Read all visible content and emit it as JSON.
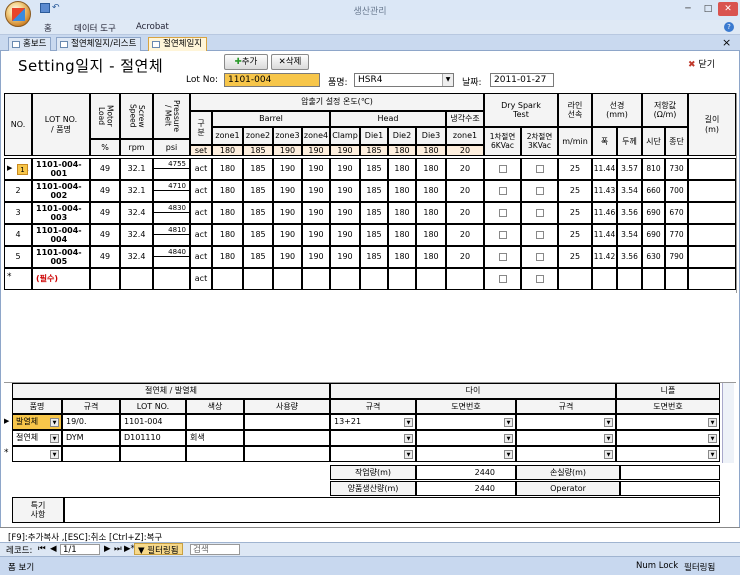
{
  "window": {
    "title": "생산관리",
    "minimize": "─",
    "maximize": "□",
    "close": "✕"
  },
  "ribbon": {
    "tabs": [
      "홈",
      "데이터 도구",
      "Acrobat"
    ]
  },
  "doc_tabs": [
    {
      "label": "홈보드"
    },
    {
      "label": "절연체일지/리스트"
    },
    {
      "label": "절연체일지"
    }
  ],
  "doc_close": "×",
  "form": {
    "title": "Setting일지  -  절연체",
    "add_label": "추가",
    "delete_label": "삭제",
    "close_label": "닫기",
    "lot_label": "Lot No:",
    "lot_value": "1101-004",
    "product_label": "품명:",
    "product_value": "HSR4",
    "date_label": "날짜:",
    "date_value": "2011-01-27"
  },
  "grid": {
    "headers": {
      "no": "NO.",
      "lot": "LOT NO.\n/ 품명",
      "motor": "Motor\nLoad",
      "screw": "Screw\nSpeed",
      "pressure": "Pressure\n/ Melt",
      "temp_group": "압출기 설정 온도(℃)",
      "gubun": "구\n분",
      "barrel": "Barrel",
      "head": "Head",
      "cool": "냉각수조",
      "zones": [
        "zone1",
        "zone2",
        "zone3",
        "zone4",
        "Clamp",
        "Die1",
        "Die2",
        "Die3",
        "zone1"
      ],
      "dry": "Dry Spark\nTest",
      "dry1": "1차절연\n6KVac",
      "dry2": "2차절연\n3KVac",
      "line": "라인\n선속",
      "line_unit": "m/min",
      "dia": "선경\n(mm)",
      "dia_w": "폭",
      "dia_t": "두께",
      "res": "저항값\n(Ω/m)",
      "res_s": "시단",
      "res_e": "종단",
      "len": "길이\n(m)",
      "motor_unit": "%",
      "screw_unit": "rpm",
      "pressure_unit": "psi",
      "set": "set",
      "set_values": [
        "180",
        "185",
        "190",
        "190",
        "190",
        "185",
        "180",
        "180",
        "20"
      ]
    },
    "rows": [
      {
        "no": "1",
        "lot": "1101-004-\n001",
        "motor": "49",
        "screw": "32.1",
        "p": "4755",
        "gubun": "act",
        "z": [
          "180",
          "185",
          "190",
          "190",
          "190",
          "185",
          "180",
          "180",
          "20"
        ],
        "line": "25",
        "w": "11.44",
        "t": "3.57",
        "rs": "810",
        "re": "730"
      },
      {
        "no": "2",
        "lot": "1101-004-\n002",
        "motor": "49",
        "screw": "32.1",
        "p": "4710",
        "gubun": "act",
        "z": [
          "180",
          "185",
          "190",
          "190",
          "190",
          "185",
          "180",
          "180",
          "20"
        ],
        "line": "25",
        "w": "11.43",
        "t": "3.54",
        "rs": "660",
        "re": "700"
      },
      {
        "no": "3",
        "lot": "1101-004-\n003",
        "motor": "49",
        "screw": "32.4",
        "p": "4830",
        "gubun": "act",
        "z": [
          "180",
          "185",
          "190",
          "190",
          "190",
          "185",
          "180",
          "180",
          "20"
        ],
        "line": "25",
        "w": "11.46",
        "t": "3.56",
        "rs": "690",
        "re": "670"
      },
      {
        "no": "4",
        "lot": "1101-004-\n004",
        "motor": "49",
        "screw": "32.4",
        "p": "4810",
        "gubun": "act",
        "z": [
          "180",
          "185",
          "190",
          "190",
          "190",
          "185",
          "180",
          "180",
          "20"
        ],
        "line": "25",
        "w": "11.44",
        "t": "3.54",
        "rs": "690",
        "re": "770"
      },
      {
        "no": "5",
        "lot": "1101-004-\n005",
        "motor": "49",
        "screw": "32.4",
        "p": "4840",
        "gubun": "act",
        "z": [
          "180",
          "185",
          "190",
          "190",
          "190",
          "185",
          "180",
          "180",
          "20"
        ],
        "line": "25",
        "w": "11.42",
        "t": "3.56",
        "rs": "630",
        "re": "790"
      }
    ],
    "new_row": {
      "marker": "*",
      "lot": "(필수)",
      "gubun": "act"
    }
  },
  "lower": {
    "insul_title": "절연체 / 발열체",
    "die_title": "다이",
    "nipple_title": "니플",
    "headers": [
      "품명",
      "규격",
      "LOT NO.",
      "색상",
      "사용량",
      "규격",
      "도면번호",
      "규격",
      "도면번호"
    ],
    "rows": [
      {
        "name": "발열체",
        "spec": "19/0.",
        "lot": "1101-004",
        "color": "",
        "use": "",
        "die_spec": "13+21",
        "die_no": "",
        "nip_spec": "",
        "nip_no": ""
      },
      {
        "name": "절연체",
        "spec": "DYM",
        "lot": "D101110",
        "color": "회색",
        "use": "",
        "die_spec": "",
        "die_no": "",
        "nip_spec": "",
        "nip_no": ""
      }
    ],
    "new_marker": "*",
    "work_label": "작업량(m)",
    "work_value": "2440",
    "good_label": "양품생산량(m)",
    "good_value": "2440",
    "loss_label": "손실량(m)",
    "loss_value": "",
    "op_label": "Operator",
    "op_value": "",
    "notes_label": "특기\n사항",
    "notes_value": ""
  },
  "statusbar": {
    "hint": "[F9]:추가복사  ,[ESC]:취소  [Ctrl+Z]:복구"
  },
  "navbar": {
    "label": "레코드:",
    "first": "⏮",
    "prev": "◀",
    "pos": "1/1",
    "next": "▶",
    "last": "⏭",
    "new": "▶*",
    "filter": "필터링됨",
    "search": "검색"
  },
  "appstatus": {
    "view": "폼 보기",
    "numlock": "Num Lock",
    "filtered": "필터링됨"
  }
}
